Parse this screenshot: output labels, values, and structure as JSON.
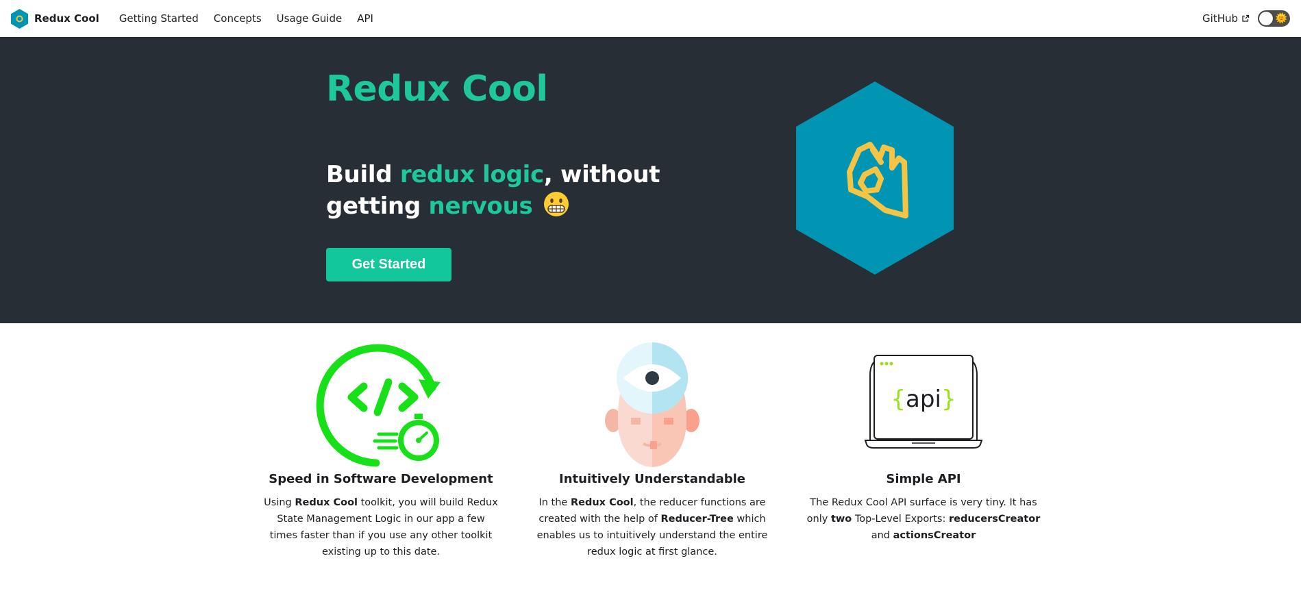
{
  "navbar": {
    "brand_title": "Redux Cool",
    "links": [
      "Getting Started",
      "Concepts",
      "Usage Guide",
      "API"
    ],
    "github_label": "GitHub",
    "theme_toggle_icon": "sun-icon"
  },
  "hero": {
    "title": "Redux Cool",
    "tagline": {
      "part1": "Build ",
      "highlight1": "redux logic",
      "part2": ", without getting ",
      "highlight2": "nervous",
      "emoji": "grimacing-face-emoji"
    },
    "cta_label": "Get Started",
    "image": "ok-hand-hexagon-icon"
  },
  "features": [
    {
      "icon": "code-speed-stopwatch-icon",
      "title": "Speed in Software Development",
      "desc": {
        "t1": "Using ",
        "b1": "Redux Cool",
        "t2": " toolkit, you will build Redux State Management Logic in our app a few times faster than if you use any other toolkit existing up to this date."
      }
    },
    {
      "icon": "third-eye-head-icon",
      "title": "Intuitively Understandable",
      "desc": {
        "t1": "In the ",
        "b1": "Redux Cool",
        "t2": ", the reducer functions are created with the help of ",
        "b2": "Reducer-Tree",
        "t3": " which enables us to intuitively understand the entire redux logic at first glance."
      }
    },
    {
      "icon": "api-laptop-icon",
      "title": "Simple API",
      "desc": {
        "t1": "The Redux Cool API surface is very tiny. It has only ",
        "b1": "two",
        "t2": " Top-Level Exports: ",
        "b2": "reducersCreator",
        "t3": " and ",
        "b3": "actionsCreator"
      },
      "api_text": "{api}"
    }
  ],
  "colors": {
    "accent": "#1fc89a",
    "hero_bg": "#282e36",
    "hex_blue": "#0096b3",
    "hand_yellow": "#f6c445",
    "feature_green": "#18e018"
  }
}
